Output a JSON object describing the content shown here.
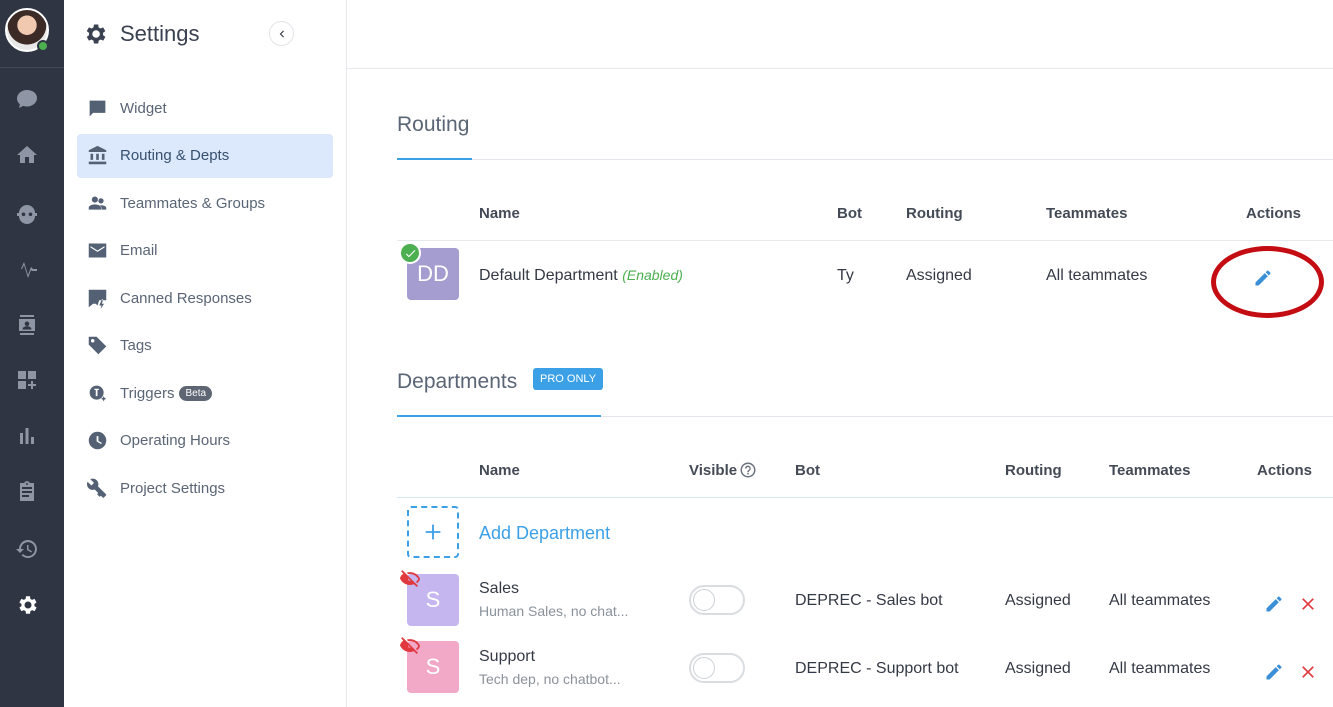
{
  "sidebar": {
    "title": "Settings",
    "items": [
      {
        "label": "Widget",
        "icon": "chat-bubble-icon"
      },
      {
        "label": "Routing & Depts",
        "icon": "bank-icon",
        "active": true
      },
      {
        "label": "Teammates & Groups",
        "icon": "people-icon"
      },
      {
        "label": "Email",
        "icon": "mail-icon"
      },
      {
        "label": "Canned Responses",
        "icon": "quick-reply-icon"
      },
      {
        "label": "Tags",
        "icon": "tag-icon"
      },
      {
        "label": "Triggers",
        "icon": "triggers-icon",
        "badge": "Beta"
      },
      {
        "label": "Operating Hours",
        "icon": "clock-icon"
      },
      {
        "label": "Project Settings",
        "icon": "tools-icon"
      }
    ]
  },
  "routing": {
    "title": "Routing",
    "headers": {
      "name": "Name",
      "bot": "Bot",
      "routing": "Routing",
      "teammates": "Teammates",
      "actions": "Actions"
    },
    "row": {
      "initials": "DD",
      "name": "Default Department",
      "status": "(Enabled)",
      "bot": "Ty",
      "routing": "Assigned",
      "teammates": "All teammates"
    }
  },
  "departments": {
    "title": "Departments",
    "badge": "PRO ONLY",
    "headers": {
      "name": "Name",
      "visible": "Visible",
      "bot": "Bot",
      "routing": "Routing",
      "teammates": "Teammates",
      "actions": "Actions"
    },
    "add_label": "Add Department",
    "rows": [
      {
        "initial": "S",
        "name": "Sales",
        "description": "Human Sales, no chat...",
        "bot": "DEPREC - Sales bot",
        "routing": "Assigned",
        "teammates": "All teammates",
        "visible": false
      },
      {
        "initial": "S",
        "name": "Support",
        "description": "Tech dep, no chatbot...",
        "bot": "DEPREC - Support bot",
        "routing": "Assigned",
        "teammates": "All teammates",
        "visible": false
      }
    ]
  },
  "colors": {
    "accent": "#3ba0e6",
    "rail": "#2f3542",
    "active_nav": "#dce8fc",
    "dd_avatar": "#a59ccf",
    "sales_avatar": "#c6b6f0",
    "support_avatar": "#f2a9c8",
    "danger": "#e0393e",
    "success": "#4caf50",
    "annotation": "#c40d12"
  }
}
